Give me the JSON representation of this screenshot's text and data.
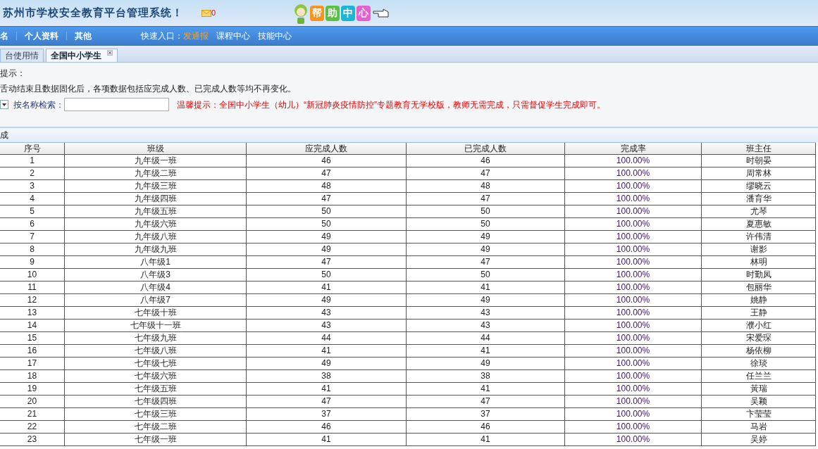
{
  "header": {
    "title": "苏州市学校安全教育平台管理系统！",
    "mail_count": "0",
    "help_tiles": [
      {
        "text": "帮",
        "color": "#f7941d"
      },
      {
        "text": "助",
        "color": "#5cc044"
      },
      {
        "text": "中",
        "color": "#1cb5d6"
      },
      {
        "text": "心",
        "color": "#e45fd0"
      }
    ]
  },
  "nav": {
    "items": [
      "名",
      "个人资料",
      "其他"
    ],
    "quick_label": "快速入口：",
    "quick_links": [
      {
        "label": "发通报",
        "highlight": true
      },
      {
        "label": "课程中心",
        "highlight": false
      },
      {
        "label": "技能中心",
        "highlight": false
      }
    ]
  },
  "tabs": [
    {
      "label": "台使用情",
      "selected": false,
      "closable": false
    },
    {
      "label": "全国中小学生",
      "selected": true,
      "closable": true
    }
  ],
  "notes": {
    "heading": "提示：",
    "line": "舌动结束且数据固化后，各项数据包括应完成人数、已完成人数等均不再变化。",
    "search_label": "按名称检索：",
    "warning": "温馨提示：全国中小学生（幼儿）“新冠肺炎疫情防控”专题教育无学校版，教师无需完成，只需督促学生完成即可。"
  },
  "section_label": "成",
  "table": {
    "columns": [
      "序号",
      "班级",
      "应完成人数",
      "已完成人数",
      "完成率",
      "班主任"
    ],
    "rows": [
      [
        "1",
        "九年级一班",
        "46",
        "46",
        "100.00%",
        "时朝晏"
      ],
      [
        "2",
        "九年级二班",
        "47",
        "47",
        "100.00%",
        "周常林"
      ],
      [
        "3",
        "九年级三班",
        "48",
        "48",
        "100.00%",
        "缪晓云"
      ],
      [
        "4",
        "九年级四班",
        "47",
        "47",
        "100.00%",
        "潘育华"
      ],
      [
        "5",
        "九年级五班",
        "50",
        "50",
        "100.00%",
        "尤琴"
      ],
      [
        "6",
        "九年级六班",
        "50",
        "50",
        "100.00%",
        "夏惠敏"
      ],
      [
        "7",
        "九年级八班",
        "49",
        "49",
        "100.00%",
        "许伟清"
      ],
      [
        "8",
        "九年级九班",
        "49",
        "49",
        "100.00%",
        "谢影"
      ],
      [
        "9",
        "八年级1",
        "47",
        "47",
        "100.00%",
        "林明"
      ],
      [
        "10",
        "八年级3",
        "50",
        "50",
        "100.00%",
        "时勤凤"
      ],
      [
        "11",
        "八年级4",
        "41",
        "41",
        "100.00%",
        "包丽华"
      ],
      [
        "12",
        "八年级7",
        "49",
        "49",
        "100.00%",
        "姚静"
      ],
      [
        "13",
        "七年级十班",
        "43",
        "43",
        "100.00%",
        "王静"
      ],
      [
        "14",
        "七年级十一班",
        "43",
        "43",
        "100.00%",
        "濮小红"
      ],
      [
        "15",
        "七年级九班",
        "44",
        "44",
        "100.00%",
        "宋爱琛"
      ],
      [
        "16",
        "七年级八班",
        "41",
        "41",
        "100.00%",
        "杨依柳"
      ],
      [
        "17",
        "七年级七班",
        "49",
        "49",
        "100.00%",
        "徐琰"
      ],
      [
        "18",
        "七年级六班",
        "38",
        "38",
        "100.00%",
        "任兰兰"
      ],
      [
        "19",
        "七年级五班",
        "41",
        "41",
        "100.00%",
        "黃瑞"
      ],
      [
        "20",
        "七年级四班",
        "47",
        "47",
        "100.00%",
        "吴颖"
      ],
      [
        "21",
        "七年级三班",
        "37",
        "37",
        "100.00%",
        "卞莹莹"
      ],
      [
        "22",
        "七年级二班",
        "46",
        "46",
        "100.00%",
        "马岩"
      ],
      [
        "23",
        "七年级一班",
        "41",
        "41",
        "100.00%",
        "吴婷"
      ]
    ]
  }
}
